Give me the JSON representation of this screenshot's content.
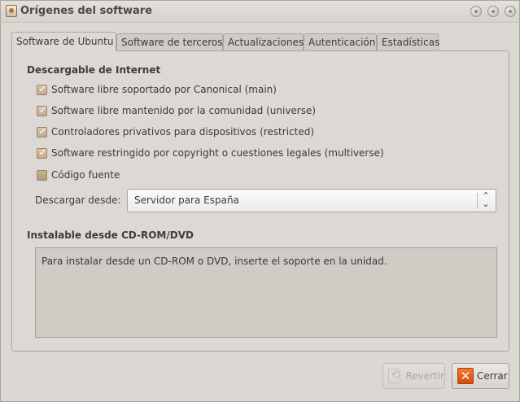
{
  "window": {
    "title": "Orígenes del software"
  },
  "tabs": [
    {
      "label": "Software de Ubuntu"
    },
    {
      "label": "Software de terceros"
    },
    {
      "label": "Actualizaciones"
    },
    {
      "label": "Autenticación"
    },
    {
      "label": "Estadísticas"
    }
  ],
  "internet": {
    "heading": "Descargable de Internet",
    "options": [
      {
        "label": "Software libre soportado por Canonical (main)",
        "checked": true
      },
      {
        "label": "Software libre mantenido por la comunidad (universe)",
        "checked": true
      },
      {
        "label": "Controladores privativos para dispositivos (restricted)",
        "checked": true
      },
      {
        "label": "Software restringido por copyright o cuestiones legales (multiverse)",
        "checked": true
      },
      {
        "label": "Código fuente",
        "checked": false
      }
    ],
    "download_from_label": "Descargar desde:",
    "download_from_value": "Servidor para España"
  },
  "cdrom": {
    "heading": "Instalable desde CD-ROM/DVD",
    "message": "Para instalar desde un CD-ROM o DVD, inserte el soporte en la unidad."
  },
  "buttons": {
    "revert": "Revertir",
    "close": "Cerrar"
  },
  "colors": {
    "window_bg": "#dbd8d3",
    "checkbox": "#c3aa8b",
    "close_icon": "#e2621c"
  }
}
